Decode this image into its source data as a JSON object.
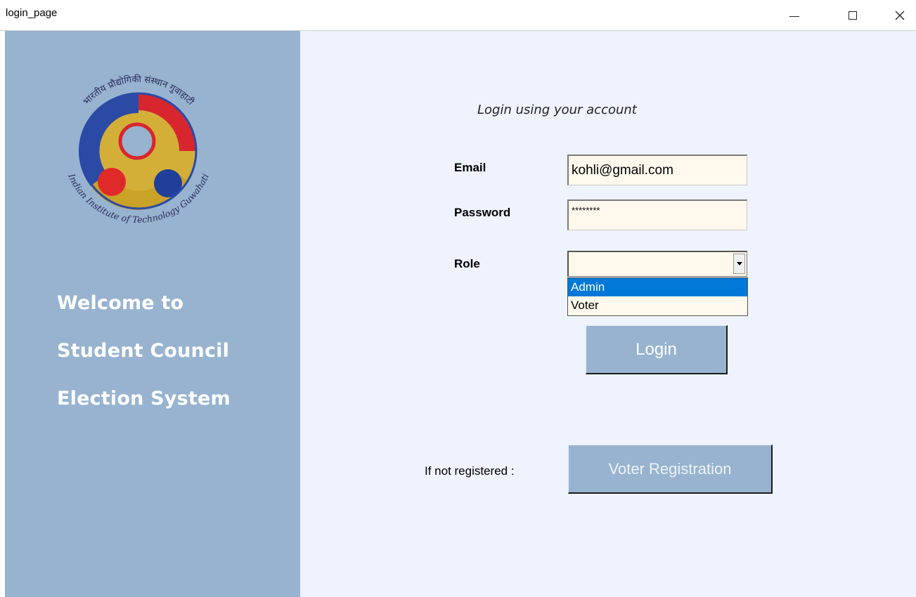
{
  "window": {
    "title": "login_page"
  },
  "sidebar": {
    "logo_icon": "iit-guwahati-logo",
    "logo_text_top": "भारतीय प्रौद्योगिकी संस्थान गुवाहाटी",
    "logo_text_bottom": "Indian Institute of Technology Guwahati",
    "welcome_line1": "Welcome to",
    "welcome_line2": "Student Council",
    "welcome_line3": "Election System",
    "background": "#97b3cf"
  },
  "form": {
    "subtitle": "Login using your account",
    "email_label": "Email",
    "email_value": "kohli@gmail.com",
    "password_label": "Password",
    "password_value": "********",
    "role_label": "Role",
    "role_value": "",
    "role_options": [
      "Admin",
      "Voter"
    ],
    "role_highlighted": "Admin",
    "login_button": "Login",
    "register_prompt": "If not registered :",
    "register_button": "Voter Registration"
  },
  "colors": {
    "accent": "#97b3cf",
    "main_bg": "#eff3fd",
    "field_bg": "#fff8ec",
    "selection": "#0078d7"
  }
}
